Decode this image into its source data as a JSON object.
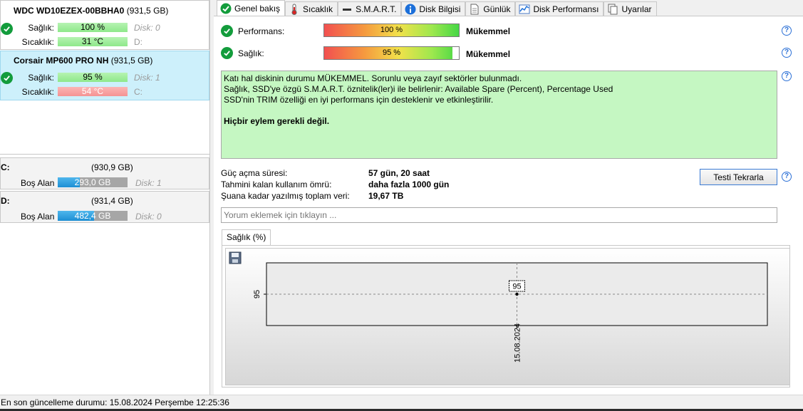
{
  "disks": [
    {
      "name": "WDC WD10EZEX-00BBHA0",
      "capacity": "(931,5 GB)",
      "health_label": "Sağlık:",
      "health_value": "100 %",
      "temp_label": "Sıcaklık:",
      "temp_value": "31 °C",
      "disk_no": "Disk: 0",
      "letter": "D:"
    },
    {
      "name": "Corsair MP600 PRO NH",
      "capacity": "(931,5 GB)",
      "health_label": "Sağlık:",
      "health_value": "95 %",
      "temp_label": "Sıcaklık:",
      "temp_value": "54 °C",
      "disk_no": "Disk: 1",
      "letter": "C:"
    }
  ],
  "volumes": [
    {
      "letter": "C:",
      "size": "(930,9 GB)",
      "free_label": "Boş Alan",
      "free_value": "293,0 GB",
      "free_fraction": 0.315,
      "disk_no": "Disk: 1"
    },
    {
      "letter": "D:",
      "size": "(931,4 GB)",
      "free_label": "Boş Alan",
      "free_value": "482,4 GB",
      "free_fraction": 0.518,
      "disk_no": "Disk: 0"
    }
  ],
  "tabs": [
    {
      "label": "Genel bakış",
      "icon": "check-circle-icon"
    },
    {
      "label": "Sıcaklık",
      "icon": "thermometer-icon"
    },
    {
      "label": "S.M.A.R.T.",
      "icon": "smart-dash-icon"
    },
    {
      "label": "Disk Bilgisi",
      "icon": "info-icon"
    },
    {
      "label": "Günlük",
      "icon": "document-icon"
    },
    {
      "label": "Disk Performansı",
      "icon": "chart-icon"
    },
    {
      "label": "Uyarılar",
      "icon": "pages-icon"
    }
  ],
  "overview": {
    "performance_label": "Performans:",
    "performance_value": "100 %",
    "performance_fraction": 1.0,
    "performance_result": "Mükemmel",
    "health_label": "Sağlık:",
    "health_value": "95 %",
    "health_fraction": 0.95,
    "health_result": "Mükemmel",
    "status_lines": [
      "Katı hal diskinin durumu MÜKEMMEL. Sorunlu veya zayıf sektörler bulunmadı.",
      "Sağlık, SSD'ye özgü S.M.A.R.T. öznitelik(ler)i ile belirlenir:  Available Spare (Percent), Percentage Used",
      "SSD'nin TRIM özelliği en iyi performans için desteklenir ve etkinleştirilir."
    ],
    "action_text": "Hiçbir eylem gerekli değil.",
    "power_on_label": "Güç açma süresi:",
    "power_on_value": "57 gün, 20 saat",
    "lifetime_label": "Tahmini kalan kullanım ömrü:",
    "lifetime_value": "daha fazla 1000 gün",
    "written_label": "Şuana kadar yazılmış toplam veri:",
    "written_value": "19,67 TB",
    "retest_button": "Testi Tekrarla",
    "comment_placeholder": "Yorum eklemek için tıklayın ...",
    "help_symbol": "?"
  },
  "chart_tab_label": "Sağlık (%)",
  "chart_data": {
    "type": "line",
    "x": [
      "15.08.2024"
    ],
    "series": [
      {
        "values": [
          95
        ]
      }
    ],
    "point_labels": [
      "95"
    ],
    "ytick_labels": [
      "95"
    ],
    "ylim": [
      90,
      100
    ],
    "grid": true
  },
  "statusbar": {
    "text": "En son güncelleme durumu: 15.08.2024 Perşembe 12:25:36"
  },
  "colors": {
    "selected_disk": "#cdf0fb",
    "ok_green": "#139c3c",
    "status_box": "#c5f7c2",
    "volume_bar": "#1d8fd4"
  }
}
